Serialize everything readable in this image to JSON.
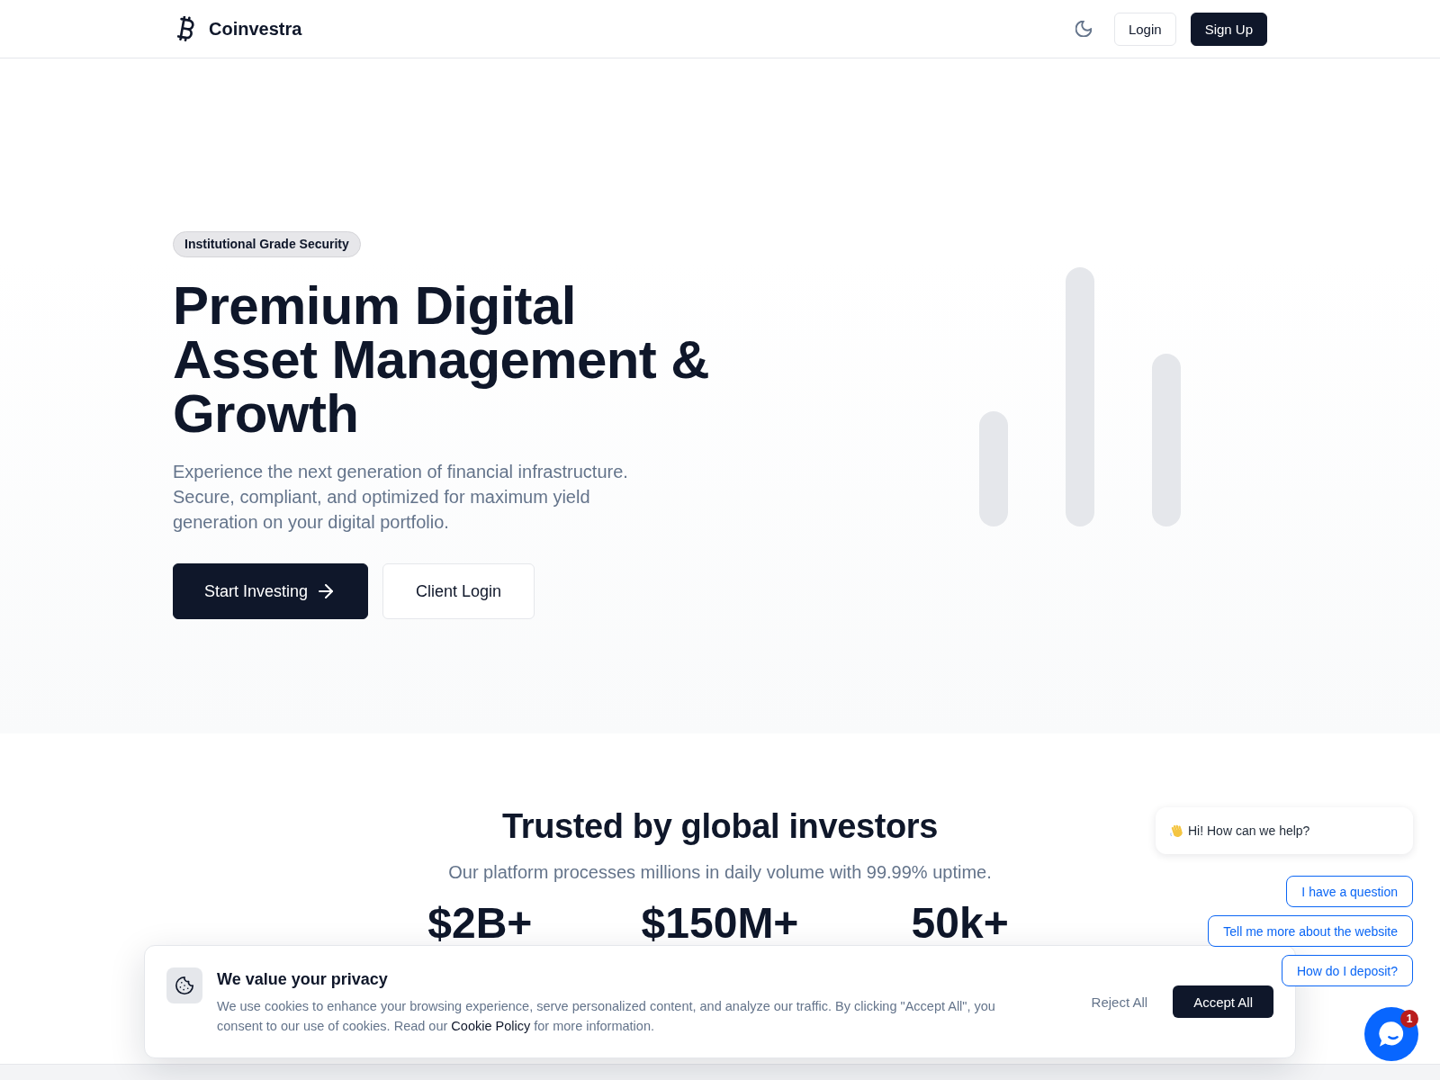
{
  "header": {
    "brand": "Coinvestra",
    "buttons": [
      {
        "label": "Login",
        "kind": "outline"
      },
      {
        "label": "Sign Up",
        "kind": "solid"
      }
    ]
  },
  "hero": {
    "badge": "Institutional Grade Security",
    "title": "Premium Digital Asset Management & Growth",
    "subtitle": "Experience the next generation of financial infrastructure. Secure, compliant, and optimized for maximum yield generation on your digital portfolio.",
    "buttons": [
      {
        "label": "Start Investing",
        "kind": "primary"
      },
      {
        "label": "Client Login",
        "kind": "secondary"
      }
    ]
  },
  "trust_section": {
    "title": "Trusted by global investors",
    "subtitle": "Our platform processes millions in daily volume with 99.99% uptime.",
    "stats": [
      "$2B+",
      "$150M+",
      "50k+"
    ]
  },
  "cookie_banner": {
    "title": "We value your privacy",
    "text_before": "We use cookies to enhance your browsing experience, serve personalized content, and analyze our traffic. By clicking \"Accept All\", you consent to our use of cookies. Read our",
    "link": "Cookie Policy",
    "text_after": "for more information.",
    "buttons": [
      {
        "label": "Reject All",
        "kind": "text"
      },
      {
        "label": "Accept All",
        "kind": "solid"
      }
    ]
  },
  "chat_widget": {
    "greeting": "Hi! How can we help?",
    "quick_replies": [
      "I have a question",
      "Tell me more about the website",
      "How do I deposit?"
    ],
    "unread_badge": "1"
  }
}
